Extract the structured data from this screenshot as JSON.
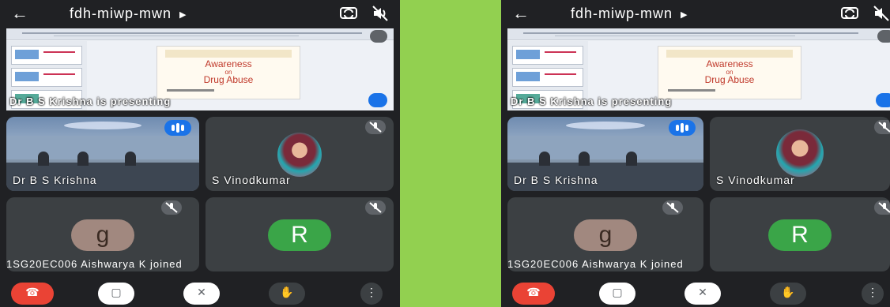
{
  "meeting": {
    "code": "fdh-miwp-mwn",
    "title_arrow": "▶",
    "back_glyph": "←"
  },
  "screen_share": {
    "presenter_text": "Dr B S Krishna is presenting",
    "slide": {
      "title_line1": "Awareness",
      "title_line2": "on",
      "title_line3": "Drug Abuse"
    }
  },
  "participants": [
    {
      "name": "Dr B S Krishna",
      "state": "speaking"
    },
    {
      "name": "S Vinodkumar",
      "state": "muted"
    },
    {
      "initial": "g",
      "color": "#a1887f",
      "state": "muted"
    },
    {
      "initial": "R",
      "color": "#3aa548",
      "state": "muted"
    }
  ],
  "notification": "1SG20EC006 Aishwarya K joined",
  "controls": {
    "end_call": "end-call",
    "camera": "camera-off",
    "mic": "mic-off",
    "raise_hand": "raise-hand",
    "more": "⋮"
  },
  "colors": {
    "background": "#92d050",
    "phone_bg": "#202124",
    "accent": "#1a73e8",
    "end_call": "#ea4335"
  }
}
